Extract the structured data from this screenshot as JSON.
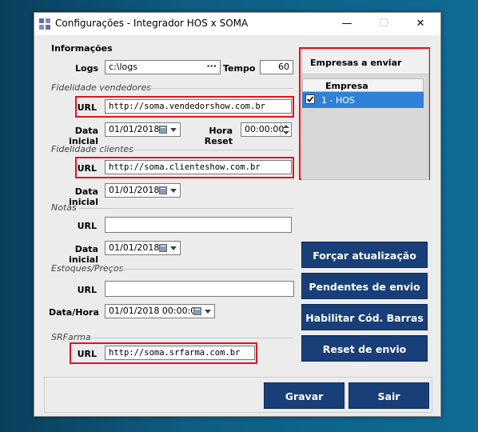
{
  "window": {
    "title": "Configurações - Integrador HOS x SOMA",
    "minimize": "—",
    "maximize": "☐",
    "close": "✕"
  },
  "informacoes": {
    "heading": "Informações",
    "logs_label": "Logs",
    "logs_value": "c:\\logs",
    "browse": "···",
    "tempo_label": "Tempo",
    "tempo_value": "60"
  },
  "fidelidade_vendedores": {
    "group_title": "Fidelidade vendedores",
    "url_label": "URL",
    "url_value": "http://soma.vendedorshow.com.br",
    "data_inicial_label": "Data inicial",
    "data_inicial_value": "01/01/2018",
    "hora_reset_label": "Hora Reset",
    "hora_reset_value": "00:00:00"
  },
  "fidelidade_clientes": {
    "group_title": "Fidelidade clientes",
    "url_label": "URL",
    "url_value": "http://soma.clienteshow.com.br",
    "data_inicial_label": "Data inicial",
    "data_inicial_value": "01/01/2018"
  },
  "notas": {
    "group_title": "Notas",
    "url_label": "URL",
    "url_value": "",
    "data_inicial_label": "Data inicial",
    "data_inicial_value": "01/01/2018"
  },
  "estoques": {
    "group_title": "Estoques/Preços",
    "url_label": "URL",
    "url_value": "",
    "data_hora_label": "Data/Hora",
    "data_hora_value": "01/01/2018 00:00:00"
  },
  "srfarma": {
    "group_title": "SRFarma",
    "url_label": "URL",
    "url_value": "http://soma.srfarma.com.br"
  },
  "empresas": {
    "heading": "Empresas a enviar",
    "column_header": "Empresa",
    "rows": [
      {
        "checked": true,
        "name": "1 - HOS"
      }
    ]
  },
  "actions": {
    "forcar": "Forçar atualização",
    "pendentes": "Pendentes de envio",
    "habilitar": "Habilitar Cód. Barras",
    "reset": "Reset de envio"
  },
  "footer": {
    "gravar": "Gravar",
    "sair": "Sair"
  },
  "colors": {
    "accent_button": "#183f77",
    "highlight_red": "#e0121f",
    "selection_blue": "#2f80d8"
  }
}
